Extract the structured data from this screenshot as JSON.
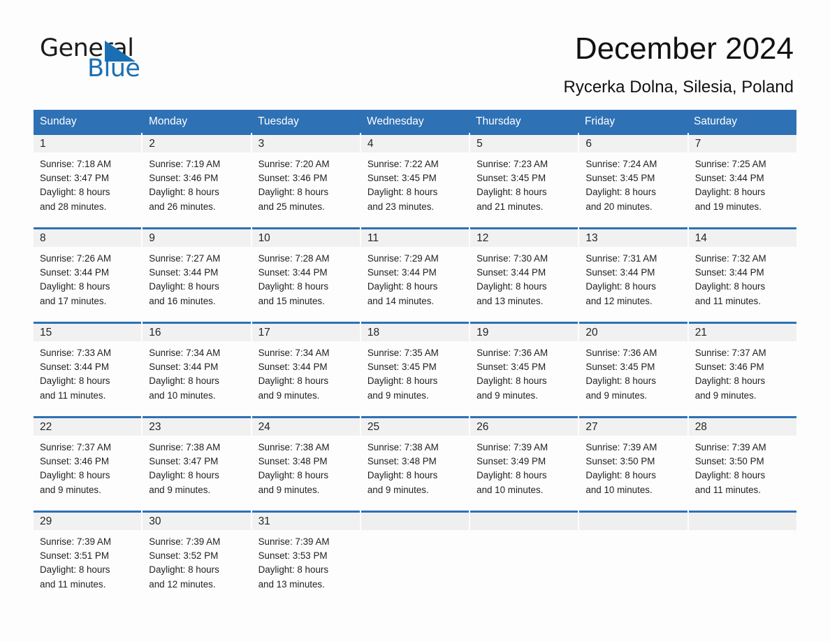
{
  "logo": {
    "word1": "General",
    "word2": "Blue",
    "triangle_color": "#1a6fb4"
  },
  "header": {
    "title": "December 2024",
    "subtitle": "Rycerka Dolna, Silesia, Poland"
  },
  "theme": {
    "header_blue": "#2e71b5",
    "day_band_gray": "#f1f1f1",
    "page_background": "#fdfdfd",
    "text_color": "#1f1f1f"
  },
  "weekdays": [
    "Sunday",
    "Monday",
    "Tuesday",
    "Wednesday",
    "Thursday",
    "Friday",
    "Saturday"
  ],
  "weeks": [
    [
      {
        "day": "1",
        "sunrise": "Sunrise: 7:18 AM",
        "sunset": "Sunset: 3:47 PM",
        "daylight1": "Daylight: 8 hours",
        "daylight2": "and 28 minutes."
      },
      {
        "day": "2",
        "sunrise": "Sunrise: 7:19 AM",
        "sunset": "Sunset: 3:46 PM",
        "daylight1": "Daylight: 8 hours",
        "daylight2": "and 26 minutes."
      },
      {
        "day": "3",
        "sunrise": "Sunrise: 7:20 AM",
        "sunset": "Sunset: 3:46 PM",
        "daylight1": "Daylight: 8 hours",
        "daylight2": "and 25 minutes."
      },
      {
        "day": "4",
        "sunrise": "Sunrise: 7:22 AM",
        "sunset": "Sunset: 3:45 PM",
        "daylight1": "Daylight: 8 hours",
        "daylight2": "and 23 minutes."
      },
      {
        "day": "5",
        "sunrise": "Sunrise: 7:23 AM",
        "sunset": "Sunset: 3:45 PM",
        "daylight1": "Daylight: 8 hours",
        "daylight2": "and 21 minutes."
      },
      {
        "day": "6",
        "sunrise": "Sunrise: 7:24 AM",
        "sunset": "Sunset: 3:45 PM",
        "daylight1": "Daylight: 8 hours",
        "daylight2": "and 20 minutes."
      },
      {
        "day": "7",
        "sunrise": "Sunrise: 7:25 AM",
        "sunset": "Sunset: 3:44 PM",
        "daylight1": "Daylight: 8 hours",
        "daylight2": "and 19 minutes."
      }
    ],
    [
      {
        "day": "8",
        "sunrise": "Sunrise: 7:26 AM",
        "sunset": "Sunset: 3:44 PM",
        "daylight1": "Daylight: 8 hours",
        "daylight2": "and 17 minutes."
      },
      {
        "day": "9",
        "sunrise": "Sunrise: 7:27 AM",
        "sunset": "Sunset: 3:44 PM",
        "daylight1": "Daylight: 8 hours",
        "daylight2": "and 16 minutes."
      },
      {
        "day": "10",
        "sunrise": "Sunrise: 7:28 AM",
        "sunset": "Sunset: 3:44 PM",
        "daylight1": "Daylight: 8 hours",
        "daylight2": "and 15 minutes."
      },
      {
        "day": "11",
        "sunrise": "Sunrise: 7:29 AM",
        "sunset": "Sunset: 3:44 PM",
        "daylight1": "Daylight: 8 hours",
        "daylight2": "and 14 minutes."
      },
      {
        "day": "12",
        "sunrise": "Sunrise: 7:30 AM",
        "sunset": "Sunset: 3:44 PM",
        "daylight1": "Daylight: 8 hours",
        "daylight2": "and 13 minutes."
      },
      {
        "day": "13",
        "sunrise": "Sunrise: 7:31 AM",
        "sunset": "Sunset: 3:44 PM",
        "daylight1": "Daylight: 8 hours",
        "daylight2": "and 12 minutes."
      },
      {
        "day": "14",
        "sunrise": "Sunrise: 7:32 AM",
        "sunset": "Sunset: 3:44 PM",
        "daylight1": "Daylight: 8 hours",
        "daylight2": "and 11 minutes."
      }
    ],
    [
      {
        "day": "15",
        "sunrise": "Sunrise: 7:33 AM",
        "sunset": "Sunset: 3:44 PM",
        "daylight1": "Daylight: 8 hours",
        "daylight2": "and 11 minutes."
      },
      {
        "day": "16",
        "sunrise": "Sunrise: 7:34 AM",
        "sunset": "Sunset: 3:44 PM",
        "daylight1": "Daylight: 8 hours",
        "daylight2": "and 10 minutes."
      },
      {
        "day": "17",
        "sunrise": "Sunrise: 7:34 AM",
        "sunset": "Sunset: 3:44 PM",
        "daylight1": "Daylight: 8 hours",
        "daylight2": "and 9 minutes."
      },
      {
        "day": "18",
        "sunrise": "Sunrise: 7:35 AM",
        "sunset": "Sunset: 3:45 PM",
        "daylight1": "Daylight: 8 hours",
        "daylight2": "and 9 minutes."
      },
      {
        "day": "19",
        "sunrise": "Sunrise: 7:36 AM",
        "sunset": "Sunset: 3:45 PM",
        "daylight1": "Daylight: 8 hours",
        "daylight2": "and 9 minutes."
      },
      {
        "day": "20",
        "sunrise": "Sunrise: 7:36 AM",
        "sunset": "Sunset: 3:45 PM",
        "daylight1": "Daylight: 8 hours",
        "daylight2": "and 9 minutes."
      },
      {
        "day": "21",
        "sunrise": "Sunrise: 7:37 AM",
        "sunset": "Sunset: 3:46 PM",
        "daylight1": "Daylight: 8 hours",
        "daylight2": "and 9 minutes."
      }
    ],
    [
      {
        "day": "22",
        "sunrise": "Sunrise: 7:37 AM",
        "sunset": "Sunset: 3:46 PM",
        "daylight1": "Daylight: 8 hours",
        "daylight2": "and 9 minutes."
      },
      {
        "day": "23",
        "sunrise": "Sunrise: 7:38 AM",
        "sunset": "Sunset: 3:47 PM",
        "daylight1": "Daylight: 8 hours",
        "daylight2": "and 9 minutes."
      },
      {
        "day": "24",
        "sunrise": "Sunrise: 7:38 AM",
        "sunset": "Sunset: 3:48 PM",
        "daylight1": "Daylight: 8 hours",
        "daylight2": "and 9 minutes."
      },
      {
        "day": "25",
        "sunrise": "Sunrise: 7:38 AM",
        "sunset": "Sunset: 3:48 PM",
        "daylight1": "Daylight: 8 hours",
        "daylight2": "and 9 minutes."
      },
      {
        "day": "26",
        "sunrise": "Sunrise: 7:39 AM",
        "sunset": "Sunset: 3:49 PM",
        "daylight1": "Daylight: 8 hours",
        "daylight2": "and 10 minutes."
      },
      {
        "day": "27",
        "sunrise": "Sunrise: 7:39 AM",
        "sunset": "Sunset: 3:50 PM",
        "daylight1": "Daylight: 8 hours",
        "daylight2": "and 10 minutes."
      },
      {
        "day": "28",
        "sunrise": "Sunrise: 7:39 AM",
        "sunset": "Sunset: 3:50 PM",
        "daylight1": "Daylight: 8 hours",
        "daylight2": "and 11 minutes."
      }
    ],
    [
      {
        "day": "29",
        "sunrise": "Sunrise: 7:39 AM",
        "sunset": "Sunset: 3:51 PM",
        "daylight1": "Daylight: 8 hours",
        "daylight2": "and 11 minutes."
      },
      {
        "day": "30",
        "sunrise": "Sunrise: 7:39 AM",
        "sunset": "Sunset: 3:52 PM",
        "daylight1": "Daylight: 8 hours",
        "daylight2": "and 12 minutes."
      },
      {
        "day": "31",
        "sunrise": "Sunrise: 7:39 AM",
        "sunset": "Sunset: 3:53 PM",
        "daylight1": "Daylight: 8 hours",
        "daylight2": "and 13 minutes."
      },
      {
        "day": "",
        "sunrise": "",
        "sunset": "",
        "daylight1": "",
        "daylight2": ""
      },
      {
        "day": "",
        "sunrise": "",
        "sunset": "",
        "daylight1": "",
        "daylight2": ""
      },
      {
        "day": "",
        "sunrise": "",
        "sunset": "",
        "daylight1": "",
        "daylight2": ""
      },
      {
        "day": "",
        "sunrise": "",
        "sunset": "",
        "daylight1": "",
        "daylight2": ""
      }
    ]
  ]
}
